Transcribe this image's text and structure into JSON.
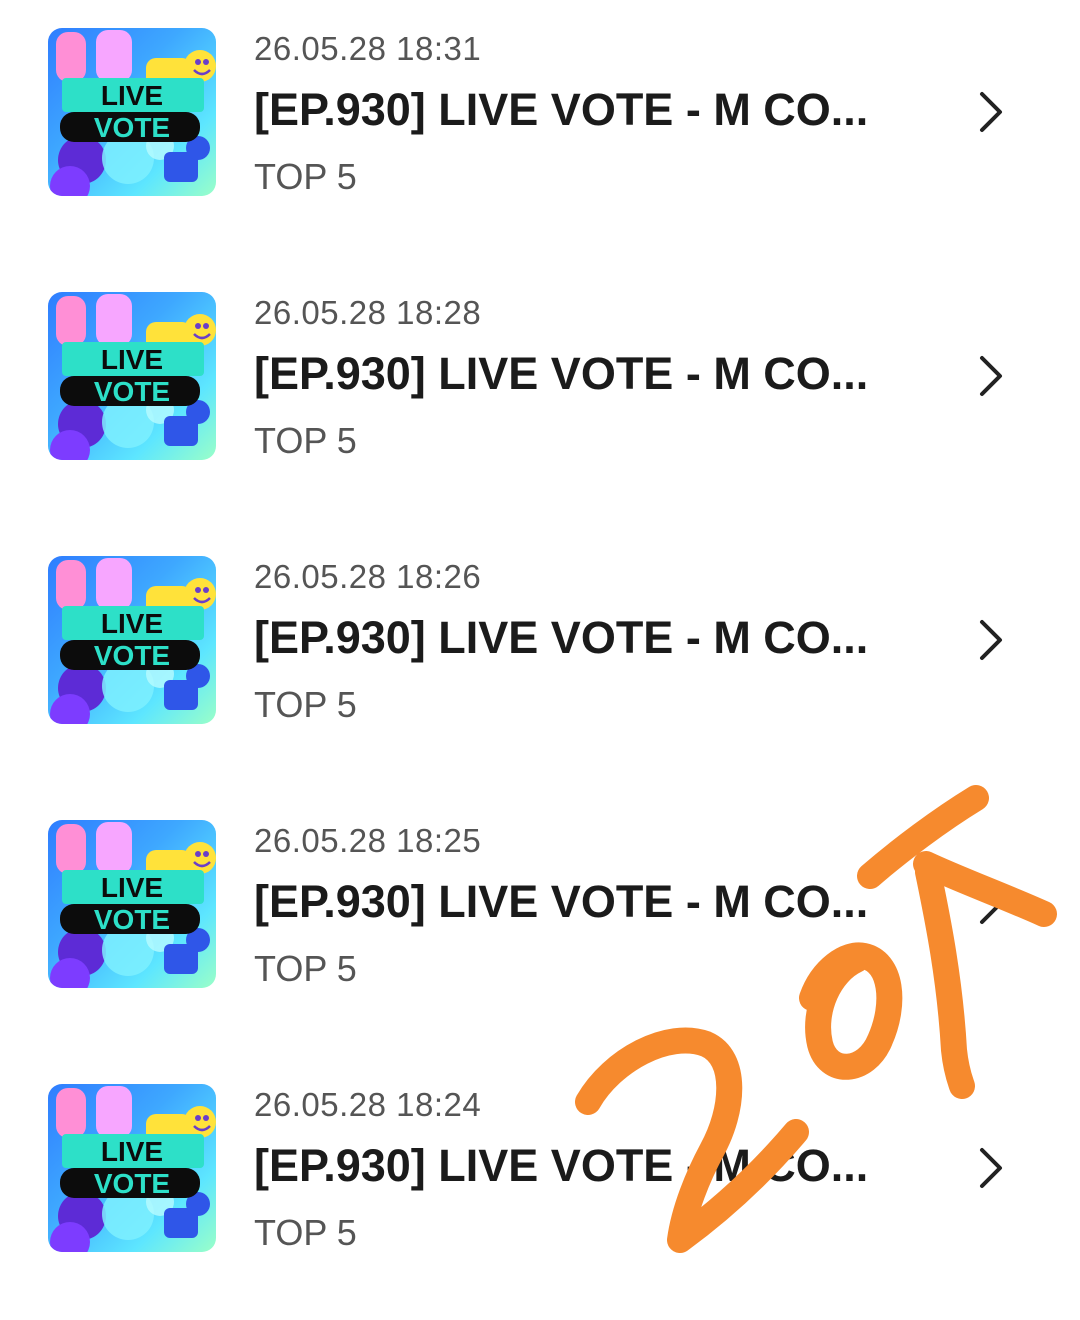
{
  "list": {
    "items": [
      {
        "timestamp": "26.05.28 18:31",
        "title": "[EP.930] LIVE VOTE - M CO...",
        "subtitle": "TOP 5",
        "thumb_text_line1": "LIVE",
        "thumb_text_line2": "VOTE"
      },
      {
        "timestamp": "26.05.28 18:28",
        "title": "[EP.930] LIVE VOTE - M CO...",
        "subtitle": "TOP 5",
        "thumb_text_line1": "LIVE",
        "thumb_text_line2": "VOTE"
      },
      {
        "timestamp": "26.05.28 18:26",
        "title": "[EP.930] LIVE VOTE - M CO...",
        "subtitle": "TOP 5",
        "thumb_text_line1": "LIVE",
        "thumb_text_line2": "VOTE"
      },
      {
        "timestamp": "26.05.28 18:25",
        "title": "[EP.930] LIVE VOTE - M CO...",
        "subtitle": "TOP 5",
        "thumb_text_line1": "LIVE",
        "thumb_text_line2": "VOTE"
      },
      {
        "timestamp": "26.05.28 18:24",
        "title": "[EP.930] LIVE VOTE - M CO...",
        "subtitle": "TOP 5",
        "thumb_text_line1": "LIVE",
        "thumb_text_line2": "VOTE"
      }
    ]
  },
  "annotation": {
    "handwritten_text": "20↑",
    "color": "#f68a2e"
  },
  "colors": {
    "title": "#1b1b1b",
    "meta": "#555555",
    "chevron": "#222222",
    "thumb_banner": "#2de0c8",
    "thumb_banner_dark": "#0c0c0c"
  },
  "icons": {
    "row_action": "chevron-right-icon",
    "thumbnail": "live-vote-thumbnail"
  }
}
